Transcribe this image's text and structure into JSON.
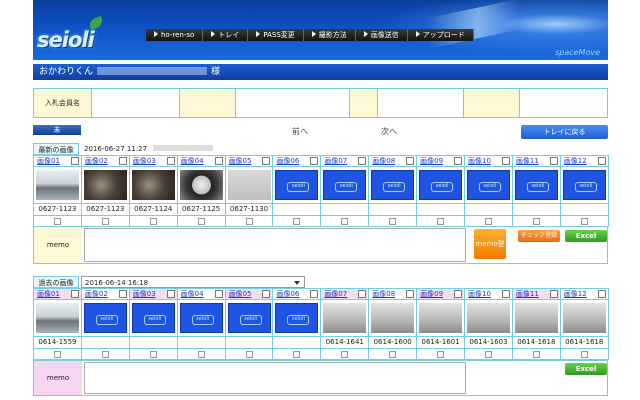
{
  "header": {
    "logo": "seioli",
    "brand": "spaceMove",
    "nav": [
      "ho-ren-so",
      "トレイ",
      "PASS変更",
      "撮影方法",
      "画像送信",
      "アップロード"
    ]
  },
  "user": {
    "name_prefix": "おかわりくん",
    "suffix": "様"
  },
  "member": {
    "label": "入札会員名"
  },
  "controls": {
    "top_button": "未",
    "prev": "前へ",
    "next": "次へ",
    "back_button": "トレイに戻る"
  },
  "latest": {
    "title": "最新の画像",
    "date": "2016-06-27 11:27",
    "headers": [
      "画像01",
      "画像02",
      "画像03",
      "画像04",
      "画像05",
      "画像06",
      "画像07",
      "画像08",
      "画像09",
      "画像10",
      "画像11",
      "画像12"
    ],
    "codes": [
      "0627-1123",
      "0627-1123",
      "0627-1124",
      "0627-1125",
      "0627-1130",
      "",
      "",
      "",
      "",
      "",
      "",
      ""
    ],
    "memo_label": "memo",
    "memo_button": "memo登",
    "check_button": "チェック登録",
    "excel_button": "Excel"
  },
  "past": {
    "title": "過去の画像",
    "date": "2016-06-14 16:18",
    "headers": [
      "画像01",
      "画像02",
      "画像03",
      "画像04",
      "画像05",
      "画像06",
      "画像07",
      "画像08",
      "画像09",
      "画像10",
      "画像11",
      "画像12"
    ],
    "codes": [
      "0614-1559",
      "",
      "",
      "",
      "",
      "",
      "0614-1641",
      "0614-1600",
      "0614-1601",
      "0614-1603",
      "0614-1618",
      "0614-1618"
    ],
    "memo_label": "memo",
    "excel_button": "Excel"
  }
}
